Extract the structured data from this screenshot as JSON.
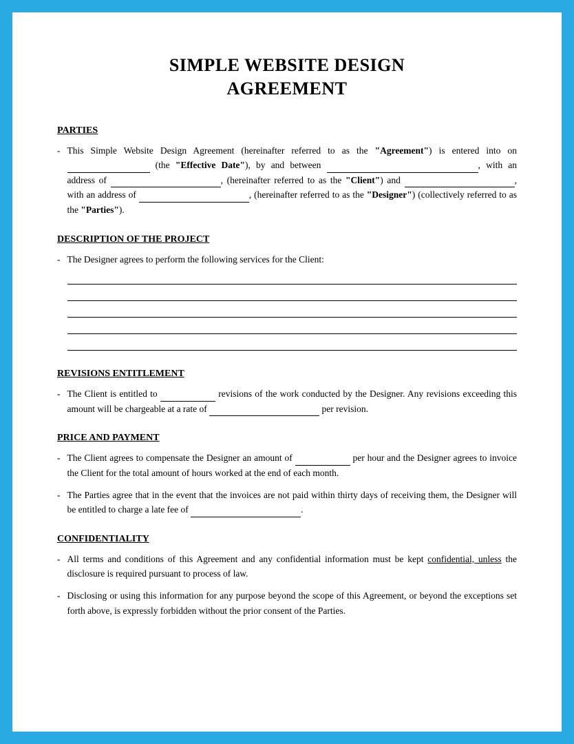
{
  "document": {
    "title_line1": "SIMPLE WEBSITE DESIGN",
    "title_line2": "AGREEMENT",
    "sections": {
      "parties": {
        "heading": "PARTIES",
        "item1": {
          "text_before": "This Simple Website Design Agreement (hereinafter referred to as the ",
          "agreement_bold": "“Agreement”",
          "text_after": ") is entered into on",
          "blank1": "",
          "text2": "(the ",
          "effective_date_bold": "“Effective Date”",
          "text3": "), by and between",
          "blank2": "",
          "text4": ", with an address of",
          "blank3": "",
          "text5": ", (hereinafter referred to as the ",
          "client_bold": "“Client”",
          "text6": ") and",
          "blank4": "",
          "text7": ", with an address of",
          "blank5": "",
          "text8": ", (hereinafter referred to as the ",
          "designer_bold": "“Designer”",
          "text9": ") (collectively referred to as the ",
          "parties_bold": "“Parties”",
          "text10": ")."
        }
      },
      "description": {
        "heading": "DESCRIPTION OF THE PROJECT",
        "item1_prefix": "The Designer agrees to perform the following services for the Client:"
      },
      "revisions": {
        "heading": "REVISIONS ENTITLEMENT",
        "item1": {
          "text1": "The Client is entitled to",
          "blank1": "",
          "text2": "revisions of the work conducted by the Designer. Any revisions exceeding this amount will be chargeable at a rate of",
          "blank2": "",
          "text3": "per revision."
        }
      },
      "price": {
        "heading": "PRICE AND PAYMENT",
        "item1": {
          "text1": "The Client agrees to compensate the Designer an amount of",
          "blank1": "",
          "text2": "per hour and the Designer agrees to invoice the Client for the total amount of hours worked at the end of each month."
        },
        "item2": {
          "text1": "The Parties agree that in the event that the invoices are not paid within thirty days of receiving them, the Designer will be entitled to charge a late fee of",
          "blank1": "",
          "text2": "."
        }
      },
      "confidentiality": {
        "heading": "CONFIDENTIALITY",
        "item1": {
          "text1": "All terms and conditions of this Agreement and any confidential information must be kept ",
          "underline_text": "confidential, unless",
          "text2": " the disclosure is required pursuant to process of law."
        },
        "item2": {
          "text1": "Disclosing or using this information for any purpose beyond the scope of this Agreement, or beyond the exceptions set forth above, is expressly forbidden without the prior consent of the Parties."
        }
      }
    }
  }
}
